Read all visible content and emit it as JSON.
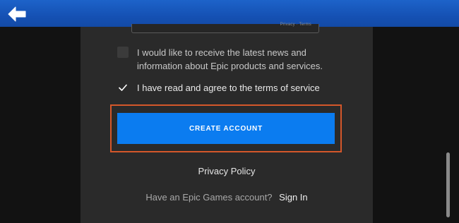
{
  "top_bar": {
    "back_icon": "back-arrow-icon",
    "color": "#1551b4"
  },
  "form": {
    "field_stub_text": "Privacy · Terms",
    "news_checkbox": {
      "label": "I would like to receive the latest news and information about Epic products and services.",
      "checked": false
    },
    "tos_checkbox": {
      "label_prefix": "I have read and agree to the",
      "link_text": "terms of service",
      "checked": true
    },
    "create_account_label": "CREATE ACCOUNT",
    "privacy_policy_label": "Privacy Policy",
    "signin_prompt": "Have an Epic Games account?",
    "signin_link": "Sign In"
  },
  "colors": {
    "accent": "#0b7cf0",
    "highlight": "#d4572a",
    "panel": "#2a2a2a",
    "background": "#121212"
  }
}
